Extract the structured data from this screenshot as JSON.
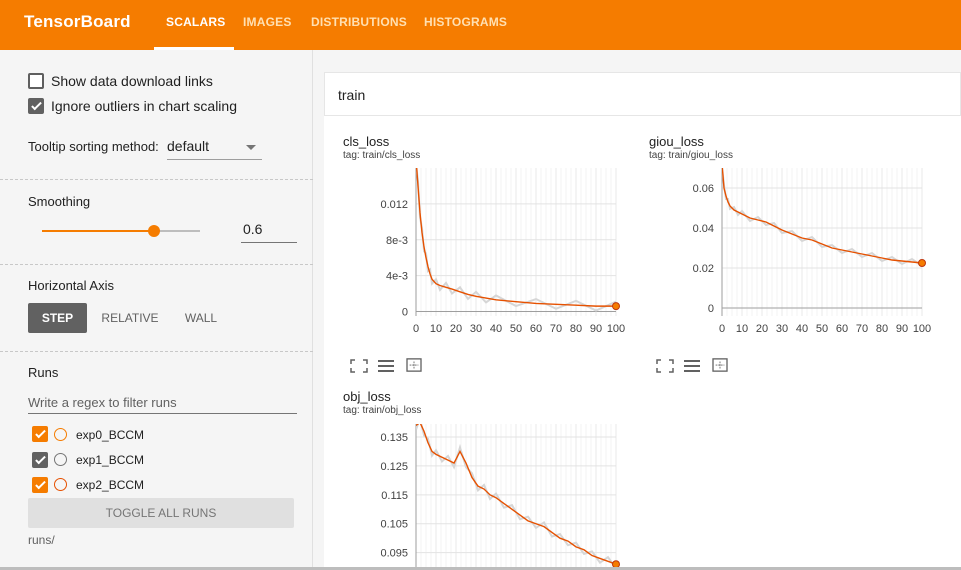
{
  "header": {
    "brand": "TensorBoard",
    "tabs": [
      {
        "label": "SCALARS",
        "active": true
      },
      {
        "label": "IMAGES",
        "active": false
      },
      {
        "label": "DISTRIBUTIONS",
        "active": false
      },
      {
        "label": "HISTOGRAMS",
        "active": false
      }
    ],
    "bar_color": "#f57c00"
  },
  "sidebar": {
    "show_download_label": "Show data download links",
    "show_download_checked": false,
    "ignore_outliers_label": "Ignore outliers in chart scaling",
    "ignore_outliers_checked": true,
    "tooltip_label": "Tooltip sorting method:",
    "tooltip_value": "default",
    "smoothing_label": "Smoothing",
    "smoothing_value": "0.6",
    "smoothing_level": 0.6,
    "haxis_label": "Horizontal Axis",
    "haxis_options": [
      "STEP",
      "RELATIVE",
      "WALL"
    ],
    "haxis_selected": "STEP",
    "runs_label": "Runs",
    "runs_filter_placeholder": "Write a regex to filter runs",
    "runs": [
      {
        "name": "exp0_BCCM",
        "checked": true,
        "color": "#f57c00"
      },
      {
        "name": "exp1_BCCM",
        "checked": true,
        "color": "#616161"
      },
      {
        "name": "exp2_BCCM",
        "checked": true,
        "color": "#f57c00"
      }
    ],
    "toggle_all_label": "TOGGLE ALL RUNS",
    "runs_dir": "runs/"
  },
  "main": {
    "group_title": "train",
    "chart_data": [
      {
        "type": "line",
        "title": "cls_loss",
        "tag": "tag: train/cls_loss",
        "xticks": [
          "0",
          "10",
          "20",
          "30",
          "40",
          "50",
          "60",
          "70",
          "80",
          "90",
          "100"
        ],
        "yticks": [
          "0",
          "4e-3",
          "8e-3",
          "0.012"
        ],
        "xlim": [
          0,
          100
        ],
        "ylim": [
          -0.0005,
          0.016
        ],
        "series": [
          {
            "color": "#e65100",
            "x": [
              0,
              1,
              2,
              3,
              4,
              5,
              6,
              7,
              8,
              10,
              12,
              15,
              18,
              22,
              26,
              30,
              35,
              40,
              50,
              60,
              70,
              80,
              90,
              100
            ],
            "y": [
              0.017,
              0.014,
              0.011,
              0.0088,
              0.0072,
              0.006,
              0.005,
              0.0042,
              0.0036,
              0.0031,
              0.0029,
              0.0027,
              0.0025,
              0.0022,
              0.0019,
              0.0017,
              0.0015,
              0.0013,
              0.0011,
              0.0009,
              0.0008,
              0.0007,
              0.0006,
              0.0006
            ]
          }
        ]
      },
      {
        "type": "line",
        "title": "giou_loss",
        "tag": "tag: train/giou_loss",
        "xticks": [
          "0",
          "10",
          "20",
          "30",
          "40",
          "50",
          "60",
          "70",
          "80",
          "90",
          "100"
        ],
        "yticks": [
          "0",
          "0.02",
          "0.04",
          "0.06"
        ],
        "xlim": [
          0,
          100
        ],
        "ylim": [
          -0.004,
          0.07
        ],
        "series": [
          {
            "color": "#e65100",
            "x": [
              0,
              1,
              2,
              3,
              4,
              6,
              8,
              10,
              14,
              18,
              22,
              26,
              30,
              35,
              40,
              45,
              50,
              55,
              60,
              65,
              70,
              75,
              80,
              85,
              90,
              95,
              100
            ],
            "y": [
              0.072,
              0.06,
              0.056,
              0.053,
              0.051,
              0.049,
              0.048,
              0.047,
              0.045,
              0.044,
              0.043,
              0.041,
              0.039,
              0.037,
              0.035,
              0.034,
              0.032,
              0.03,
              0.029,
              0.028,
              0.027,
              0.026,
              0.025,
              0.024,
              0.0235,
              0.023,
              0.0225
            ]
          }
        ]
      },
      {
        "type": "line",
        "title": "obj_loss",
        "tag": "tag: train/obj_loss",
        "yticks": [
          "0.095",
          "0.105",
          "0.115",
          "0.125",
          "0.135"
        ],
        "xlim": [
          0,
          100
        ],
        "ylim": [
          0.089,
          0.1395
        ],
        "series": [
          {
            "color": "#e65100",
            "x": [
              0,
              2,
              4,
              6,
              8,
              10,
              13,
              16,
              19,
              22,
              25,
              28,
              31,
              34,
              37,
              40,
              44,
              48,
              52,
              56,
              60,
              64,
              68,
              72,
              76,
              80,
              84,
              88,
              92,
              96,
              100
            ],
            "y": [
              0.139,
              0.14,
              0.137,
              0.133,
              0.13,
              0.129,
              0.128,
              0.127,
              0.126,
              0.13,
              0.126,
              0.121,
              0.118,
              0.117,
              0.115,
              0.114,
              0.112,
              0.11,
              0.108,
              0.106,
              0.105,
              0.104,
              0.102,
              0.1,
              0.099,
              0.097,
              0.096,
              0.094,
              0.093,
              0.092,
              0.091
            ]
          }
        ]
      }
    ]
  }
}
